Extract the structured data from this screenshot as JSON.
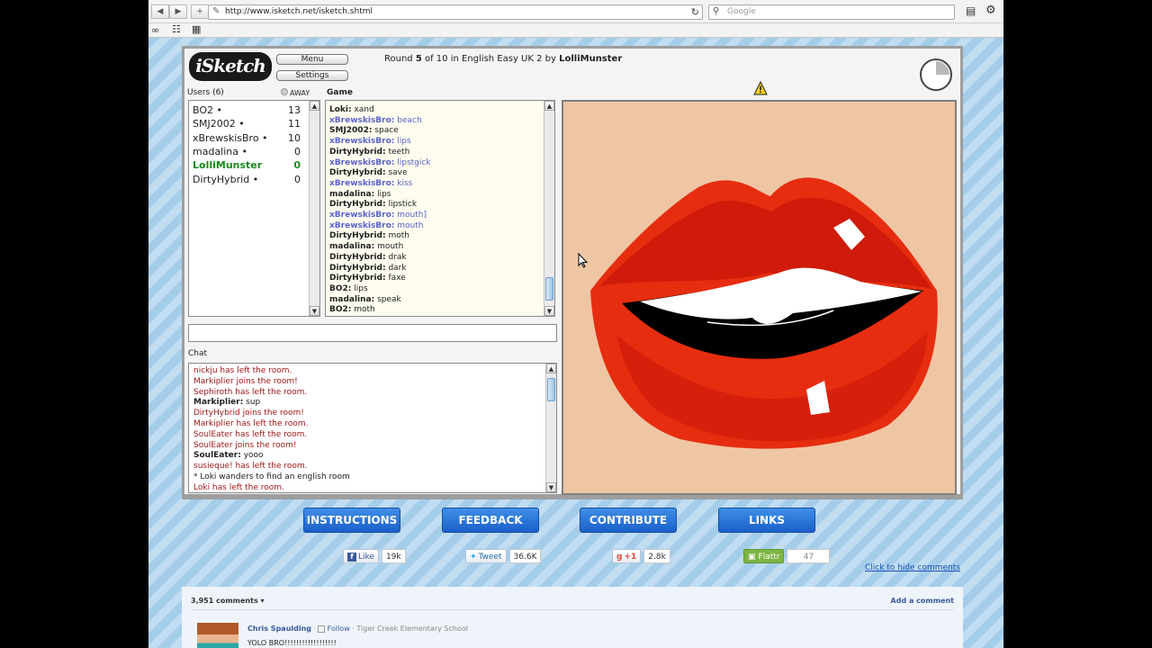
{
  "browser": {
    "url": "http://www.isketch.net/isketch.shtml",
    "search_placeholder": "Google"
  },
  "game": {
    "logo": "iSketch",
    "menu_label": "Menu",
    "settings_label": "Settings",
    "round_prefix": "Round ",
    "round_num": "5",
    "round_of": " of ",
    "round_total": "10",
    "round_suffix": " in English Easy UK 2 by ",
    "round_host": "LolliMunster",
    "users_label": "Users (6)",
    "away_label": "AWAY",
    "game_label": "Game",
    "chat_label": "Chat",
    "users": [
      {
        "name": "BO2 •",
        "score": "13",
        "color": "#222222"
      },
      {
        "name": "SMJ2002 •",
        "score": "11",
        "color": "#222222"
      },
      {
        "name": "xBrewskisBro •",
        "score": "10",
        "color": "#222222"
      },
      {
        "name": "madalina •",
        "score": "0",
        "color": "#222222"
      },
      {
        "name": "LolliMunster",
        "score": "0",
        "color": "#1a8a1a"
      },
      {
        "name": "DirtyHybrid •",
        "score": "0",
        "color": "#222222"
      }
    ],
    "game_log": [
      {
        "name": "Loki:",
        "text": " xand",
        "color": "#222222"
      },
      {
        "name": "xBrewskisBro:",
        "text": " beach",
        "color": "#5a63c9"
      },
      {
        "name": "SMJ2002:",
        "text": " space",
        "color": "#222222"
      },
      {
        "name": "xBrewskisBro:",
        "text": " lips",
        "color": "#5a63c9"
      },
      {
        "name": "DirtyHybrid:",
        "text": " teeth",
        "color": "#222222"
      },
      {
        "name": "xBrewskisBro:",
        "text": " lipstgick",
        "color": "#5a63c9"
      },
      {
        "name": "DirtyHybrid:",
        "text": " save",
        "color": "#222222"
      },
      {
        "name": "xBrewskisBro:",
        "text": " kiss",
        "color": "#5a63c9"
      },
      {
        "name": "madalina:",
        "text": " lips",
        "color": "#222222"
      },
      {
        "name": "DirtyHybrid:",
        "text": " lipstick",
        "color": "#222222"
      },
      {
        "name": "xBrewskisBro:",
        "text": " mouth]",
        "color": "#5a63c9"
      },
      {
        "name": "xBrewskisBro:",
        "text": " mouth",
        "color": "#5a63c9"
      },
      {
        "name": "DirtyHybrid:",
        "text": " moth",
        "color": "#222222"
      },
      {
        "name": "madalina:",
        "text": " mouth",
        "color": "#222222"
      },
      {
        "name": "DirtyHybrid:",
        "text": " drak",
        "color": "#222222"
      },
      {
        "name": "DirtyHybrid:",
        "text": " dark",
        "color": "#222222"
      },
      {
        "name": "DirtyHybrid:",
        "text": " faxe",
        "color": "#222222"
      },
      {
        "name": "BO2:",
        "text": " lips",
        "color": "#222222"
      },
      {
        "name": "madalina:",
        "text": " speak",
        "color": "#222222"
      },
      {
        "name": "BO2:",
        "text": " moth",
        "color": "#222222"
      }
    ],
    "chat_log": [
      {
        "name": "",
        "text": "nickju has left the room.",
        "color": "#a01818"
      },
      {
        "name": "",
        "text": "Markiplier joins the room!",
        "color": "#a01818"
      },
      {
        "name": "",
        "text": "Sephiroth has left the room.",
        "color": "#a01818"
      },
      {
        "name": "Markiplier:",
        "text": " sup",
        "color": "#222222"
      },
      {
        "name": "",
        "text": "DirtyHybrid joins the room!",
        "color": "#a01818"
      },
      {
        "name": "",
        "text": "Markiplier has left the room.",
        "color": "#a01818"
      },
      {
        "name": "",
        "text": "SoulEater has left the room.",
        "color": "#a01818"
      },
      {
        "name": "",
        "text": "SoulEater joins the room!",
        "color": "#a01818"
      },
      {
        "name": "SoulEater:",
        "text": " yooo",
        "color": "#222222"
      },
      {
        "name": "",
        "text": "susieque! has left the room.",
        "color": "#a01818"
      },
      {
        "name": "",
        "text": "* Loki wanders to find an english room",
        "color": "#222222"
      },
      {
        "name": "",
        "text": "Loki has left the room.",
        "color": "#a01818"
      }
    ]
  },
  "buttons": {
    "instructions": "INSTRUCTIONS",
    "feedback": "FEEDBACK",
    "contribute": "CONTRIBUTE",
    "links": "LINKS"
  },
  "social": {
    "like_label": "Like",
    "like_count": "19k",
    "tweet_label": "Tweet",
    "tweet_count": "36.6K",
    "plusone_label": "+1",
    "plusone_count": "2.8k",
    "flattr_label": "Flattr",
    "flattr_count": "47"
  },
  "comments": {
    "hide_link": "Click to hide comments",
    "count_label": "3,951 comments",
    "add_label": "Add a comment",
    "author": "Chris Spaulding",
    "follow": "Follow",
    "school": "Tiger Creek Elementary School",
    "text": "YOLO BRO!!!!!!!!!!!!!!!!!!"
  },
  "colors": {
    "canvas_bg": "#efc6a4",
    "lip_red": "#e62d10",
    "lip_dark": "#c81508",
    "accent_button": "#2a6fd8"
  }
}
